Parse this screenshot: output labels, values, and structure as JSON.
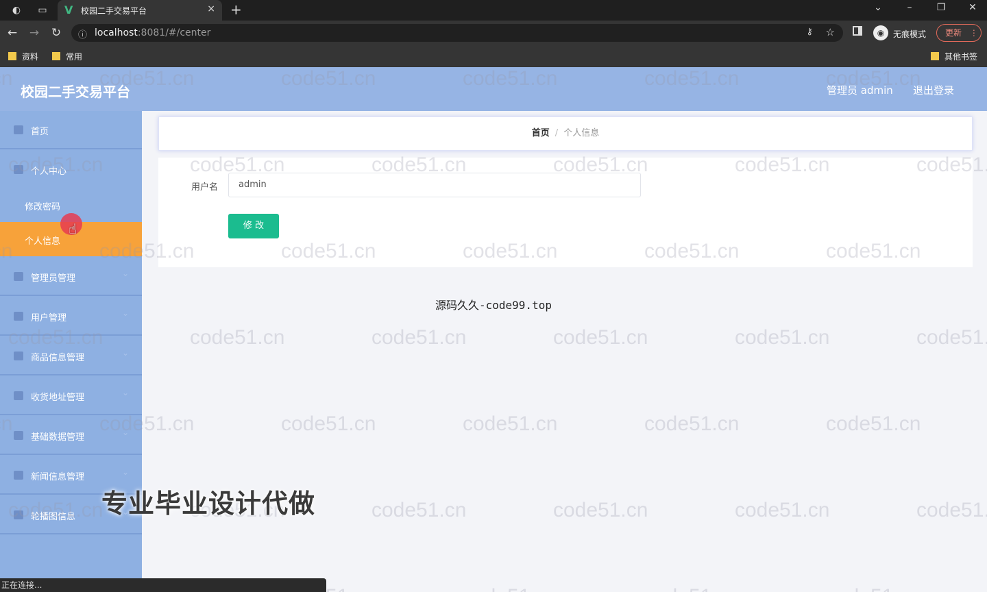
{
  "browser": {
    "tab_title": "校园二手交易平台",
    "tab_close": "×",
    "new_tab": "+",
    "url_host": "localhost",
    "url_rest": ":8081/#/center",
    "incognito_label": "无痕模式",
    "update_label": "更新",
    "bookmarks": [
      "资料",
      "常用"
    ],
    "other_bookmarks": "其他书签",
    "status_text": "正在连接..."
  },
  "app": {
    "title": "校园二手交易平台",
    "user_label": "管理员 admin",
    "logout_label": "退出登录"
  },
  "sidebar": {
    "items": [
      {
        "label": "首页",
        "icon": "home-icon"
      },
      {
        "label": "个人中心",
        "icon": "user-icon"
      },
      {
        "label": "管理员管理",
        "icon": "admin-icon"
      },
      {
        "label": "用户管理",
        "icon": "users-icon"
      },
      {
        "label": "商品信息管理",
        "icon": "goods-icon"
      },
      {
        "label": "收货地址管理",
        "icon": "address-icon"
      },
      {
        "label": "基础数据管理",
        "icon": "data-icon"
      },
      {
        "label": "新闻信息管理",
        "icon": "news-icon"
      },
      {
        "label": "轮播图信息",
        "icon": "carousel-icon"
      }
    ],
    "sub_items": [
      {
        "label": "修改密码"
      },
      {
        "label": "个人信息"
      }
    ]
  },
  "breadcrumb": {
    "home": "首页",
    "separator": "/",
    "current": "个人信息"
  },
  "form": {
    "username_label": "用户名",
    "username_value": "admin",
    "submit_label": "修 改"
  },
  "overlay": {
    "ad_text": "源码久久-code99.top",
    "promo_text": "专业毕业设计代做",
    "watermark": "code51.cn"
  },
  "colors": {
    "header": "#96b4e4",
    "sidebar": "#8eb0e2",
    "active_item": "#f7a23a",
    "submit_button": "#1bbc8f"
  }
}
